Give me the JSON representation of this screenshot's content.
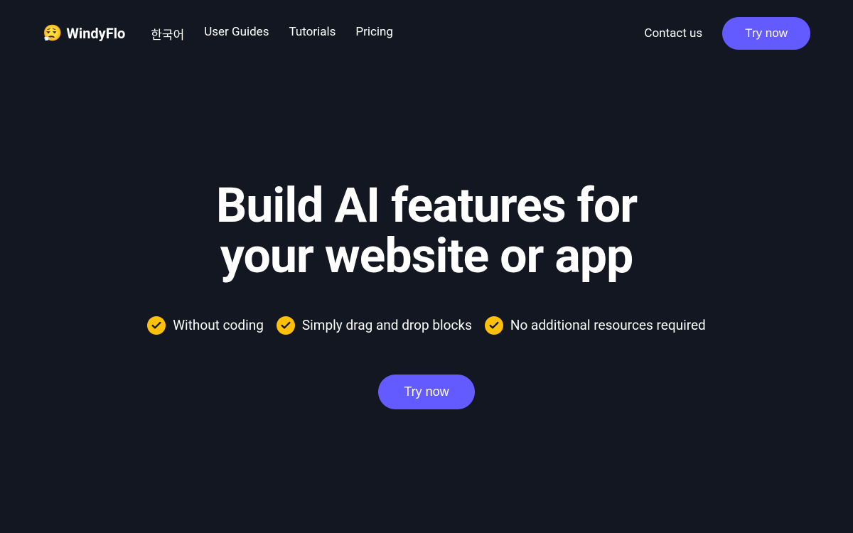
{
  "brand": {
    "name": "WindyFlo",
    "icon": "😮‍💨"
  },
  "nav": {
    "links": [
      {
        "label": "한국어"
      },
      {
        "label": "User Guides"
      },
      {
        "label": "Tutorials"
      },
      {
        "label": "Pricing"
      }
    ],
    "contact": "Contact us",
    "cta": "Try now"
  },
  "hero": {
    "title_line1": "Build AI features for",
    "title_line2": "your website or app",
    "features": [
      {
        "text": "Without coding"
      },
      {
        "text": "Simply drag and drop blocks"
      },
      {
        "text": "No additional resources required"
      }
    ],
    "cta": "Try now"
  },
  "colors": {
    "background": "#131722",
    "primary": "#635BFF",
    "accent": "#FFC107"
  }
}
